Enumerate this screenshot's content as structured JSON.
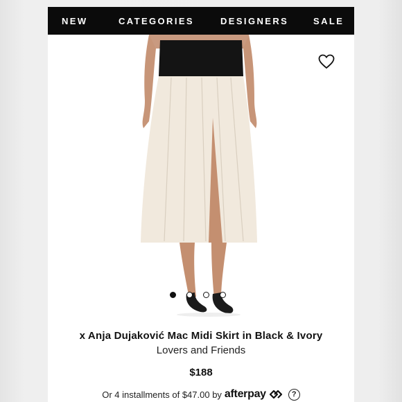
{
  "nav": {
    "items": [
      "NEW",
      "CATEGORIES",
      "DESIGNERS",
      "SALE"
    ]
  },
  "product": {
    "title": "x Anja Dujaković Mac Midi Skirt in Black & Ivory",
    "brand": "Lovers and Friends",
    "price": "$188",
    "installment_text": "Or 4 installments of $47.00 by",
    "payment_provider": "afterpay",
    "help_label": "?"
  },
  "gallery": {
    "image_count": 4,
    "active_index": 0
  },
  "icons": {
    "favorite": "heart-icon",
    "payment": "afterpay-logo-icon",
    "help": "question-circle-icon"
  },
  "colors": {
    "nav_background": "#0b0b0b",
    "nav_text": "#ffffff",
    "skirt_waistband": "#141414",
    "skirt_body": "#f1e9dd"
  }
}
